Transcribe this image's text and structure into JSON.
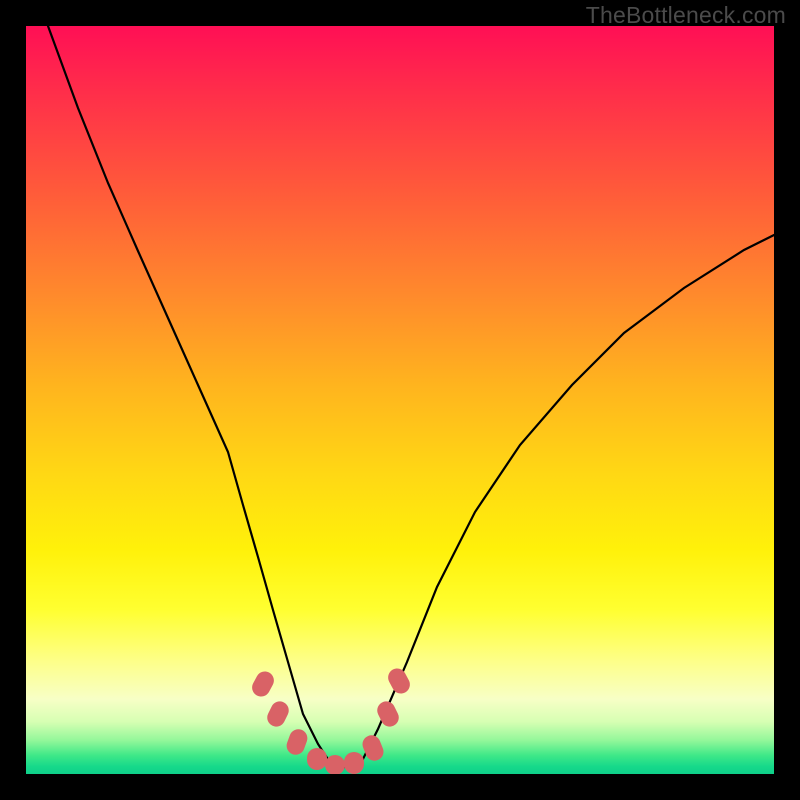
{
  "watermark": "TheBottleneck.com",
  "chart_data": {
    "type": "line",
    "title": "",
    "xlabel": "",
    "ylabel": "",
    "xlim": [
      0,
      100
    ],
    "ylim": [
      0,
      100
    ],
    "background_gradient_meaning": "color encodes bottleneck severity; red = high (~100), green = low (~0)",
    "series": [
      {
        "name": "bottleneck-curve",
        "stroke": "#000000",
        "x": [
          3,
          7,
          11,
          15,
          19,
          23,
          27,
          29,
          31,
          33,
          35,
          37,
          39,
          41,
          43,
          45,
          47,
          51,
          55,
          60,
          66,
          73,
          80,
          88,
          96,
          100
        ],
        "values": [
          100,
          89,
          79,
          70,
          61,
          52,
          43,
          36,
          29,
          22,
          15,
          8,
          4,
          1,
          1,
          2,
          6,
          15,
          25,
          35,
          44,
          52,
          59,
          65,
          70,
          72
        ]
      },
      {
        "name": "optimal-range-markers",
        "stroke": "#d96266",
        "marker_shape": "rounded-rect",
        "x": [
          31.5,
          33.5,
          36.0,
          38.5,
          41.0,
          43.5,
          46.0,
          48.0,
          49.5
        ],
        "values": [
          12.0,
          8.0,
          4.0,
          1.5,
          0.8,
          1.2,
          3.5,
          8.0,
          12.5
        ]
      }
    ]
  }
}
